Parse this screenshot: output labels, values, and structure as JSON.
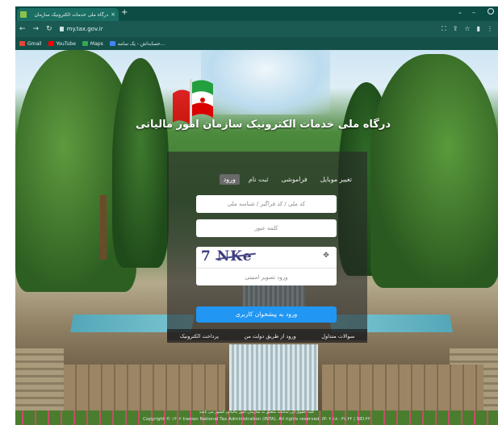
{
  "browser": {
    "tab_title": "درگاه ملی خدمات الکترونیک سازمان",
    "tab_close": "×",
    "new_tab": "+",
    "url": "my.tax.gov.ir",
    "bookmarks": [
      {
        "label": "Gmail",
        "color": "#ea4335"
      },
      {
        "label": "YouTube",
        "color": "#ff0000"
      },
      {
        "label": "Maps",
        "color": "#34a853"
      },
      {
        "label": "حسابداش - یک سامه...",
        "color": "#4285f4"
      }
    ]
  },
  "header": {
    "title": "درگاه ملی خدمات الکترونیک سازمان امور مالیاتی"
  },
  "login": {
    "tabs": [
      {
        "label": "ورود",
        "active": true
      },
      {
        "label": "ثبت نام",
        "active": false
      },
      {
        "label": "فراموشی",
        "active": false
      },
      {
        "label": "تغییر موبایل",
        "active": false
      }
    ],
    "username_placeholder": "کد ملی / کد فراگیر / شناسه ملی",
    "password_placeholder": "کلمه عبور",
    "captcha_text": "7 NKe",
    "captcha_placeholder": "ورود تصویر امنیتی",
    "submit_label": "ورود به پیشخوان کاربری"
  },
  "links": [
    "پرداخت الکترونیک",
    "ورود از طریق دولت من",
    "سوالات متداول"
  ],
  "footer": {
    "fa": "کلیه حقوق این سامانه متعلق به سازمان امور مالیاتی کشور می باشد",
    "en": "Copyright © ۱۴۰۲ Iranian National Tax Administration (INTA). All rights reserved. IP: ۲.۱۸۰.۳۶.۴۴ | SID:۴۴"
  },
  "colors": {
    "chrome": "#0b4d45",
    "accent": "#2196f3"
  }
}
